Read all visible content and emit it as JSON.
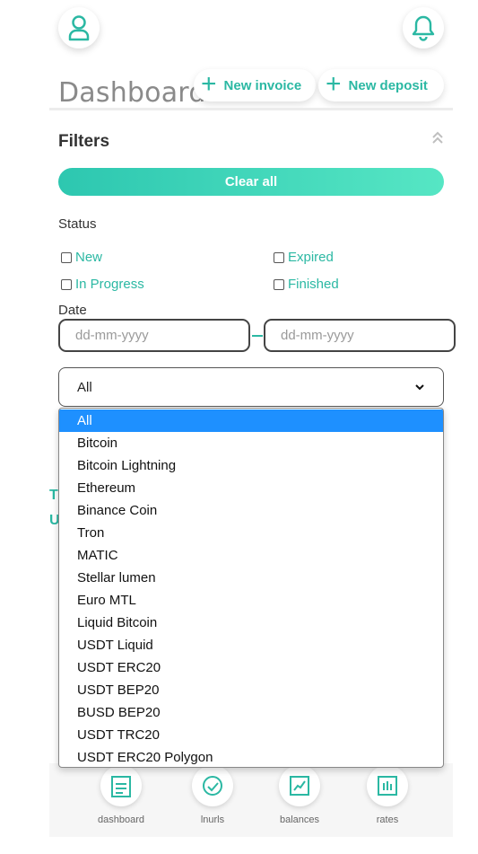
{
  "header": {
    "title": "Dashboard",
    "new_invoice_label": "New invoice",
    "new_deposit_label": "New deposit",
    "profile_icon": "user-icon",
    "notification_icon": "bell-icon"
  },
  "filters": {
    "title": "Filters",
    "clear_all_label": "Clear all",
    "status_label": "Status",
    "statuses": {
      "new": "New",
      "expired": "Expired",
      "in_progress": "In Progress",
      "finished": "Finished"
    },
    "date_label": "Date",
    "date_from_placeholder": "dd-mm-yyyy",
    "date_to_placeholder": "dd-mm-yyyy",
    "currency_selected": "All",
    "currency_options": [
      "All",
      "Bitcoin",
      "Bitcoin Lightning",
      "Ethereum",
      "Binance Coin",
      "Tron",
      "MATIC",
      "Stellar lumen",
      "Euro MTL",
      "Liquid Bitcoin",
      "USDT Liquid",
      "USDT ERC20",
      "USDT BEP20",
      "BUSD BEP20",
      "USDT TRC20",
      "USDT ERC20 Polygon"
    ]
  },
  "background_fragments": {
    "line1": "T",
    "line2": "U"
  },
  "nav": {
    "dashboard": "dashboard",
    "lnurls": "lnurls",
    "balances": "balances",
    "rates": "rates"
  },
  "colors": {
    "accent": "#2bb8a3",
    "selected_option": "#1e90ff"
  }
}
